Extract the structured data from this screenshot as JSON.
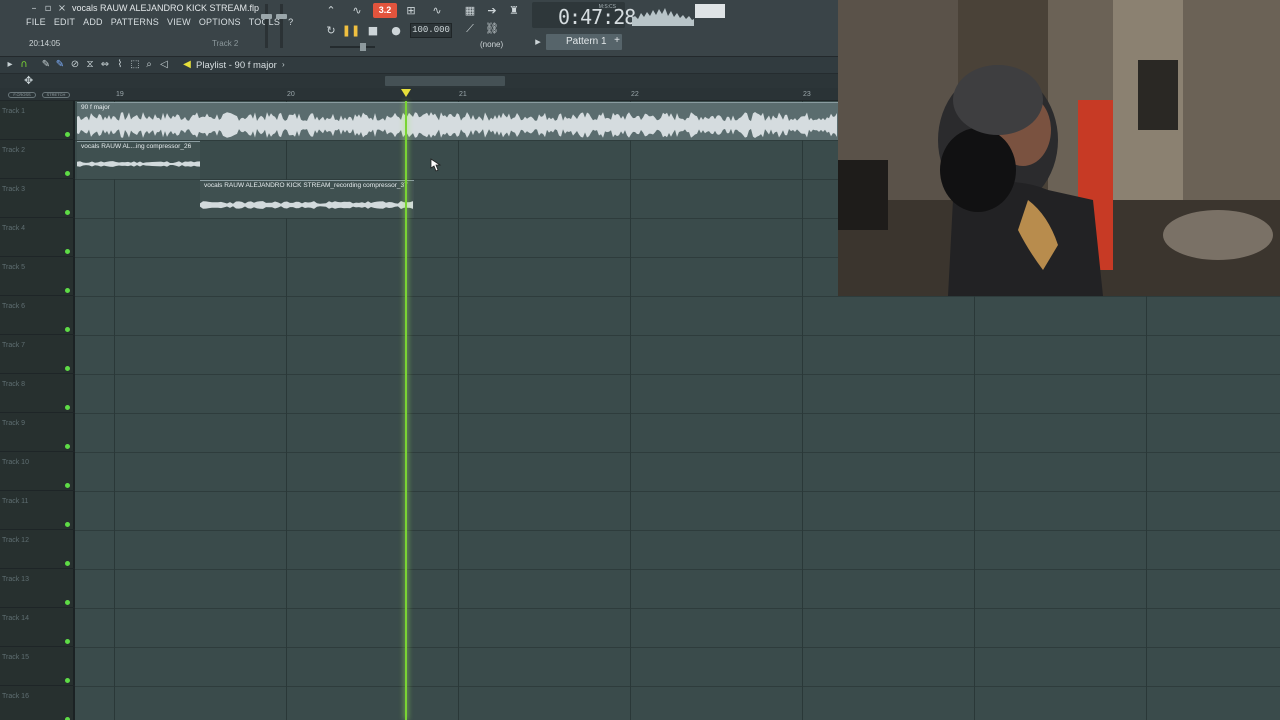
{
  "window": {
    "file_title": "vocals RAUW ALEJANDRO KICK STREAM.flp"
  },
  "menu": [
    "FILE",
    "EDIT",
    "ADD",
    "PATTERNS",
    "VIEW",
    "OPTIONS",
    "TOOLS",
    "?"
  ],
  "status": {
    "clock": "20:14:05",
    "hint": "Track 2"
  },
  "transport": {
    "tempo": "100.000",
    "time": "0:47:28",
    "time_unit_label": "M:S:CS",
    "record_mode_label": "3.2",
    "snap": "(none)",
    "pattern": "Pattern 1"
  },
  "playlist": {
    "title": "Playlist - 90 f major",
    "bar_numbers": [
      "19",
      "20",
      "21",
      "22",
      "23"
    ],
    "ruler_pills": [
      "F.CROSS",
      "STRETCH"
    ],
    "tracks": [
      "Track 1",
      "Track 2",
      "Track 3",
      "Track 4",
      "Track 5",
      "Track 6",
      "Track 7",
      "Track 8",
      "Track 9",
      "Track 10",
      "Track 11",
      "Track 12",
      "Track 13",
      "Track 14",
      "Track 15",
      "Track 16"
    ],
    "clips": {
      "clip1": "90 f major",
      "clip2": "vocals RAUW AL...ing compressor_26",
      "clip3": "vocals RAUW ALEJANDRO KICK STREAM_recording compressor_37"
    }
  },
  "colors": {
    "grid": "#3a4b4b",
    "playhead": "#7ad433",
    "track_led": "#5edc46",
    "record_active": "#e2543d"
  },
  "icons": {
    "window": [
      "minimize-icon",
      "restore-icon",
      "close-icon"
    ],
    "header": [
      "play-arrow-icon",
      "magnet-icon",
      "pencil-icon",
      "brush-icon",
      "delete-icon",
      "mute-icon",
      "slip-icon",
      "slice-icon",
      "select-icon",
      "zoom-icon",
      "playback-icon",
      "speaker-icon"
    ]
  }
}
